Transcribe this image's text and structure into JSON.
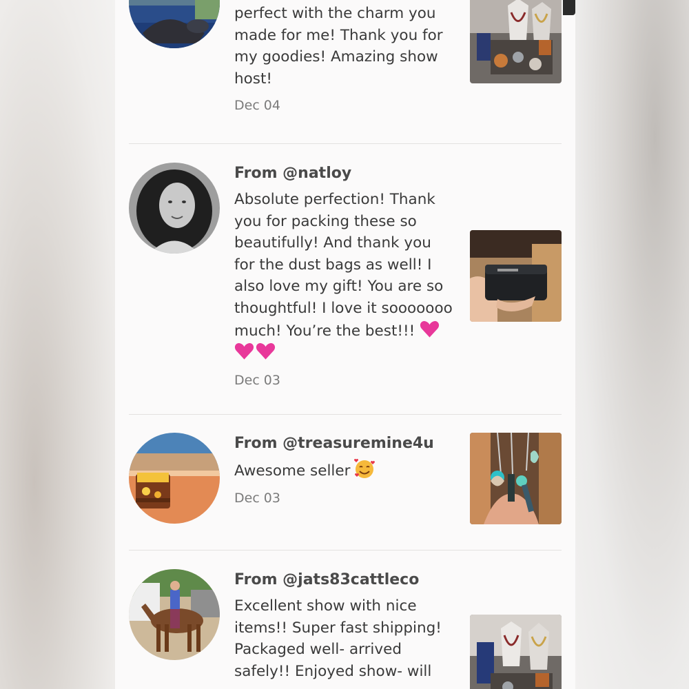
{
  "reviews": [
    {
      "from": "",
      "text": "perfect with the charm you made for me! Thank you for my goodies! Amazing show host!",
      "date": "Dec 04",
      "avatar_icon": "person-on-yoga-mat-avatar",
      "thumb_icon": "jewelry-display-thumbnail"
    },
    {
      "from": "From @natloy",
      "text": "Absolute perfection! Thank you for packing these so beautifully! And thank you for the dust bags as well! I also love my gift! You are so thoughtful! I love it sooooooo much! You’re the best!!!",
      "emoji": "pink-heart-emoji",
      "date": "Dec 03",
      "avatar_icon": "woman-portrait-avatar",
      "thumb_icon": "black-wallet-thumbnail"
    },
    {
      "from": "From @treasuremine4u",
      "text": "Awesome seller",
      "emoji": "smiling-face-with-hearts-emoji",
      "date": "Dec 03",
      "avatar_icon": "treasure-chest-beach-avatar",
      "thumb_icon": "charm-keychains-thumbnail"
    },
    {
      "from": "From @jats83cattleco",
      "text": "Excellent show with nice items!! Super fast shipping! Packaged well- arrived safely!! Enjoyed show- will",
      "date": "",
      "avatar_icon": "rider-on-mule-avatar",
      "thumb_icon": "jewelry-display-thumbnail"
    }
  ],
  "colors": {
    "panel_bg": "#fbfafa",
    "text": "#3a3a3a",
    "date": "#7b7b7b",
    "divider": "#e3e1e0",
    "heart": "#e8389a"
  }
}
